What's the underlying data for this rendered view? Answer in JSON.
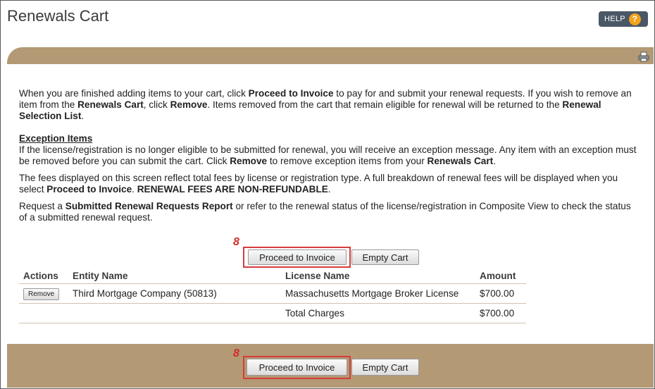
{
  "header": {
    "title": "Renewals Cart",
    "help_label": "HELP",
    "help_icon_glyph": "?"
  },
  "icons": {
    "print": "print-icon"
  },
  "intro": {
    "p1": {
      "a": "When you are finished adding items to your cart, click ",
      "b1": "Proceed to Invoice",
      "c": " to pay for and submit your renewal requests. If you wish to remove an item from the ",
      "b2": "Renewals Cart",
      "d": ", click ",
      "b3": "Remove",
      "e": ". Items removed from the cart that remain eligible for renewal will be returned to the ",
      "b4": "Renewal Selection List",
      "f": "."
    },
    "exception": {
      "title": "Exception Items",
      "a": "If the license/registration is no longer eligible to be submitted for renewal, you will receive an exception message. Any item with an exception must be removed before you can submit the cart. Click ",
      "b1": "Remove",
      "c": " to remove exception items from your ",
      "b2": "Renewals Cart",
      "d": "."
    },
    "fees": {
      "a": "The fees displayed on this screen reflect total fees by license or registration type. A full breakdown of renewal fees will be displayed when you select ",
      "b1": "Proceed to Invoice",
      "c": ". ",
      "b2": "RENEWAL FEES ARE NON-REFUNDABLE",
      "d": "."
    },
    "report": {
      "a": "Request a ",
      "b1": "Submitted Renewal Requests Report",
      "c": " or refer to the renewal status of the license/registration in Composite View to check the status of a submitted renewal request."
    }
  },
  "annotation_marker": "8",
  "buttons": {
    "proceed": "Proceed to Invoice",
    "empty": "Empty Cart",
    "remove": "Remove"
  },
  "table": {
    "headers": [
      "Actions",
      "Entity Name",
      "License Name",
      "Amount"
    ],
    "rows": [
      {
        "entity": "Third Mortgage Company (50813)",
        "license": "Massachusetts Mortgage Broker License",
        "amount": "$700.00"
      }
    ],
    "total_label": "Total Charges",
    "total_amount": "$700.00"
  },
  "colors": {
    "bar": "#b39a74",
    "highlight": "#d63c3c",
    "help_bg": "#4a5766",
    "help_icon": "#f4a21c"
  }
}
